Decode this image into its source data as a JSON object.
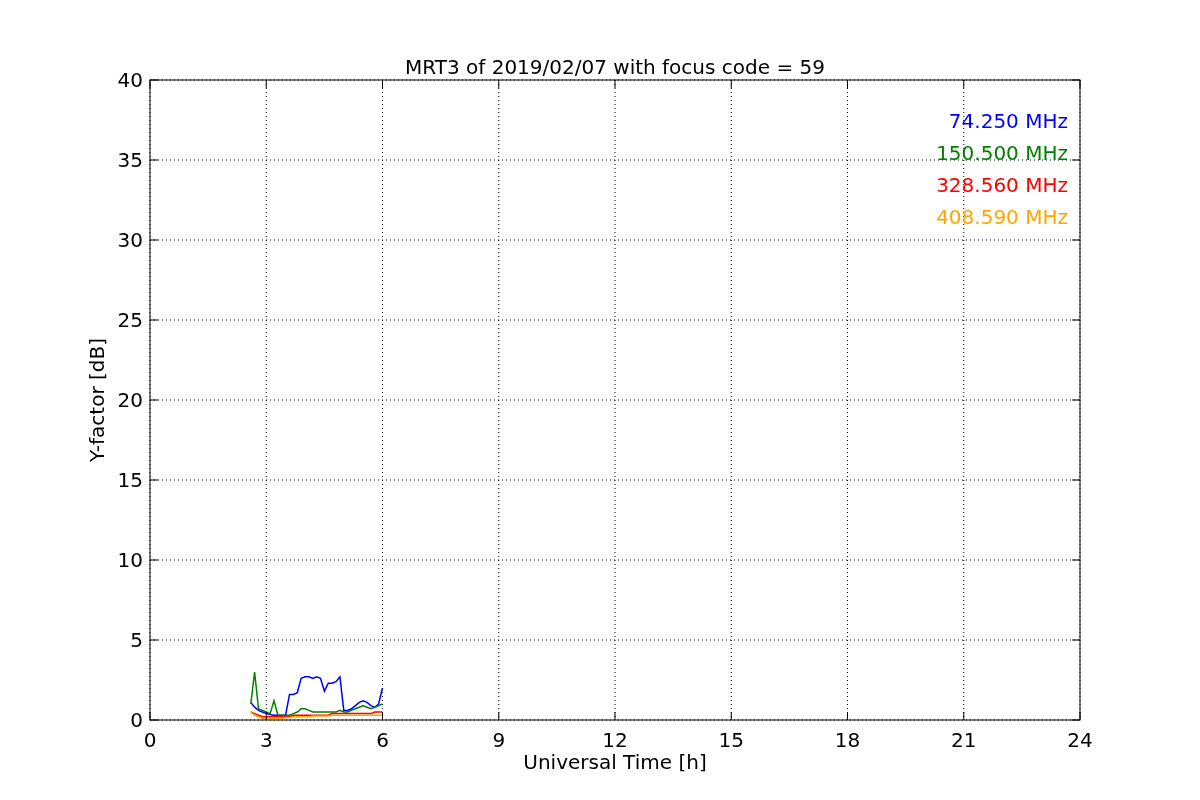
{
  "chart_data": {
    "type": "line",
    "title": "MRT3 of 2019/02/07 with focus code = 59",
    "xlabel": "Universal Time [h]",
    "ylabel": "Y-factor [dB]",
    "x": [
      2.6,
      2.7,
      2.8,
      2.9,
      3.0,
      3.1,
      3.2,
      3.3,
      3.4,
      3.5,
      3.6,
      3.7,
      3.8,
      3.9,
      4.0,
      4.1,
      4.2,
      4.3,
      4.4,
      4.5,
      4.6,
      4.7,
      4.8,
      4.9,
      5.0,
      5.1,
      5.2,
      5.3,
      5.4,
      5.5,
      5.6,
      5.7,
      5.8,
      5.9,
      6.0
    ],
    "series": [
      {
        "name": "74.250 MHz",
        "color": "#0000ff",
        "values": [
          1.1,
          0.8,
          0.6,
          0.5,
          0.4,
          0.35,
          0.3,
          0.3,
          0.3,
          0.3,
          1.6,
          1.6,
          1.7,
          2.6,
          2.7,
          2.7,
          2.6,
          2.7,
          2.6,
          1.8,
          2.3,
          2.3,
          2.4,
          2.7,
          0.6,
          0.6,
          0.7,
          0.9,
          1.1,
          1.2,
          1.1,
          0.9,
          0.8,
          1.0,
          2.0
        ]
      },
      {
        "name": "150.500 MHz",
        "color": "#008000",
        "values": [
          1.0,
          3.0,
          0.7,
          0.6,
          0.5,
          0.4,
          1.2,
          0.3,
          0.3,
          0.3,
          0.3,
          0.4,
          0.5,
          0.7,
          0.7,
          0.6,
          0.5,
          0.5,
          0.5,
          0.5,
          0.5,
          0.5,
          0.5,
          0.6,
          0.5,
          0.5,
          0.6,
          0.7,
          0.8,
          0.9,
          0.8,
          0.7,
          0.8,
          0.9,
          1.0
        ]
      },
      {
        "name": "328.560 MHz",
        "color": "#ff0000",
        "values": [
          0.5,
          0.4,
          0.3,
          0.2,
          0.2,
          0.2,
          0.2,
          0.2,
          0.2,
          0.2,
          0.2,
          0.3,
          0.3,
          0.3,
          0.3,
          0.3,
          0.3,
          0.3,
          0.3,
          0.3,
          0.3,
          0.4,
          0.4,
          0.4,
          0.4,
          0.4,
          0.4,
          0.4,
          0.4,
          0.4,
          0.4,
          0.4,
          0.5,
          0.5,
          0.5
        ]
      },
      {
        "name": "408.590 MHz",
        "color": "#ffa500",
        "values": [
          0.5,
          0.3,
          0.2,
          0.1,
          0.1,
          0.1,
          0.1,
          0.1,
          0.1,
          0.15,
          0.15,
          0.2,
          0.2,
          0.2,
          0.2,
          0.2,
          0.25,
          0.25,
          0.25,
          0.25,
          0.25,
          0.3,
          0.3,
          0.3,
          0.3,
          0.3,
          0.3,
          0.3,
          0.3,
          0.3,
          0.3,
          0.3,
          0.3,
          0.3,
          0.3
        ]
      }
    ],
    "grid": true,
    "xlim": [
      0,
      24
    ],
    "ylim": [
      0,
      40
    ],
    "xticks": [
      0,
      3,
      6,
      9,
      12,
      15,
      18,
      21,
      24
    ],
    "yticks": [
      0,
      5,
      10,
      15,
      20,
      25,
      30,
      35,
      40
    ]
  }
}
